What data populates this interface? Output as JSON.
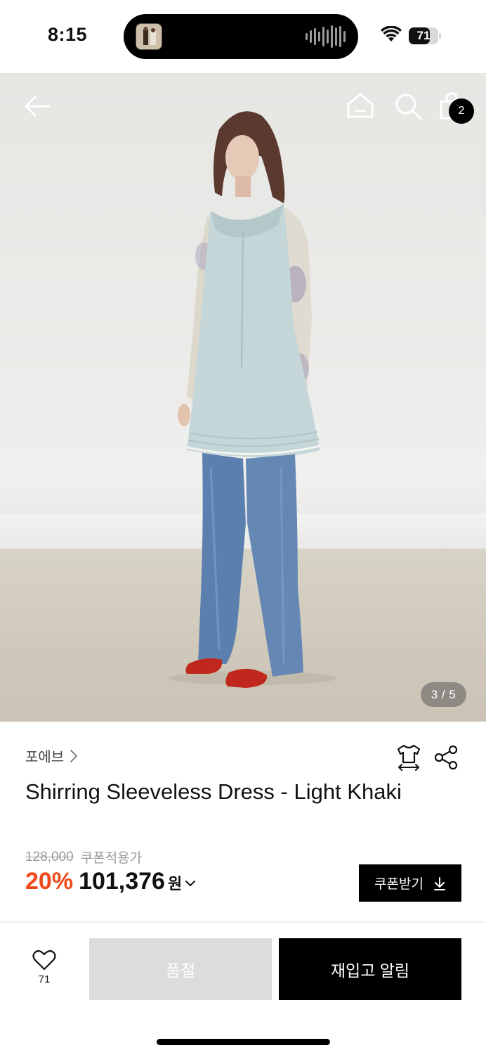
{
  "status_bar": {
    "time": "8:15",
    "battery_level": "71",
    "battery_fraction": 0.71
  },
  "hero": {
    "image_counter": "3 / 5",
    "cart_badge": "2",
    "icons": [
      "back-arrow-icon",
      "home-icon",
      "search-icon",
      "shopping-bag-icon"
    ]
  },
  "product": {
    "brand": "포에브",
    "title": "Shirring Sleeveless Dress - Light Khaki",
    "original_price": "128,000",
    "coupon_note": "쿠폰적용가",
    "discount": "20%",
    "sale_price": "101,376",
    "currency": "원",
    "coupon_button_label": "쿠폰받기"
  },
  "action_bar": {
    "like_count": "71",
    "soldout_label": "품절",
    "restock_label": "재입고 알림"
  },
  "colors": {
    "discount": "#ee4a1c",
    "primary_button": "#000000",
    "disabled_button": "#dcdcdc"
  }
}
